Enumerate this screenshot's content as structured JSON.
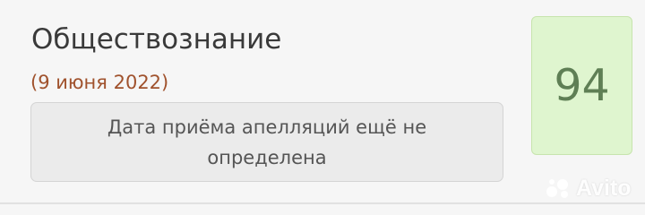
{
  "exam": {
    "subject": "Обществознание",
    "date": "(9 июня 2022)",
    "appeal_status": "Дата приёма апелляций ещё не определена",
    "score": "94"
  },
  "watermark": {
    "brand": "Avito",
    "icon": "avito-logo-icon"
  },
  "colors": {
    "date_accent": "#a0522d",
    "score_background": "#dff5cf",
    "score_text": "#5f7f55"
  }
}
